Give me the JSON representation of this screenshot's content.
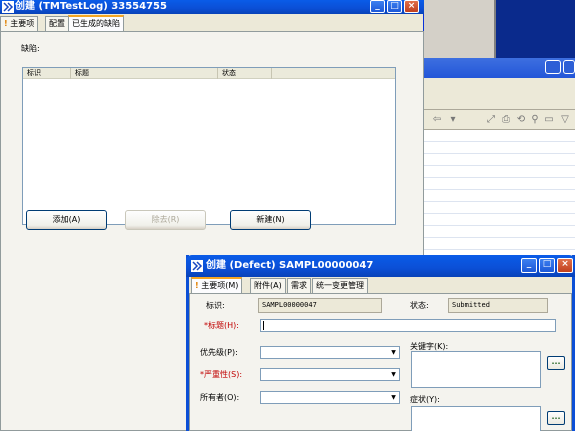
{
  "window_main": {
    "title": "创建 (TMTestLog) 33554755",
    "tabs": [
      "主要项",
      "配置",
      "已生成的缺陷"
    ],
    "section_label": "缺陷:",
    "table_columns": [
      "标识",
      "标题",
      "状态"
    ],
    "buttons": {
      "add": "添加(A)",
      "remove": "除去(R)",
      "new": "新建(N)"
    }
  },
  "window_defect": {
    "title": "创建 (Defect) SAMPL00000047",
    "tabs": [
      "主要项(M)",
      "附件(A)",
      "需求",
      "统一变更管理"
    ],
    "fields": {
      "id_label": "标识:",
      "id_value": "SAMPL00000047",
      "state_label": "状态:",
      "state_value": "Submitted",
      "headline_label": "*标题(H):",
      "priority_label": "优先级(P):",
      "severity_label": "*严重性(S):",
      "owner_label": "所有者(O):",
      "keywords_label": "关键字(K):",
      "symptoms_label": "症状(Y):",
      "ellipsis": "..."
    }
  },
  "title_controls": {
    "minimize": "_",
    "maximize": "□",
    "close": "×"
  }
}
